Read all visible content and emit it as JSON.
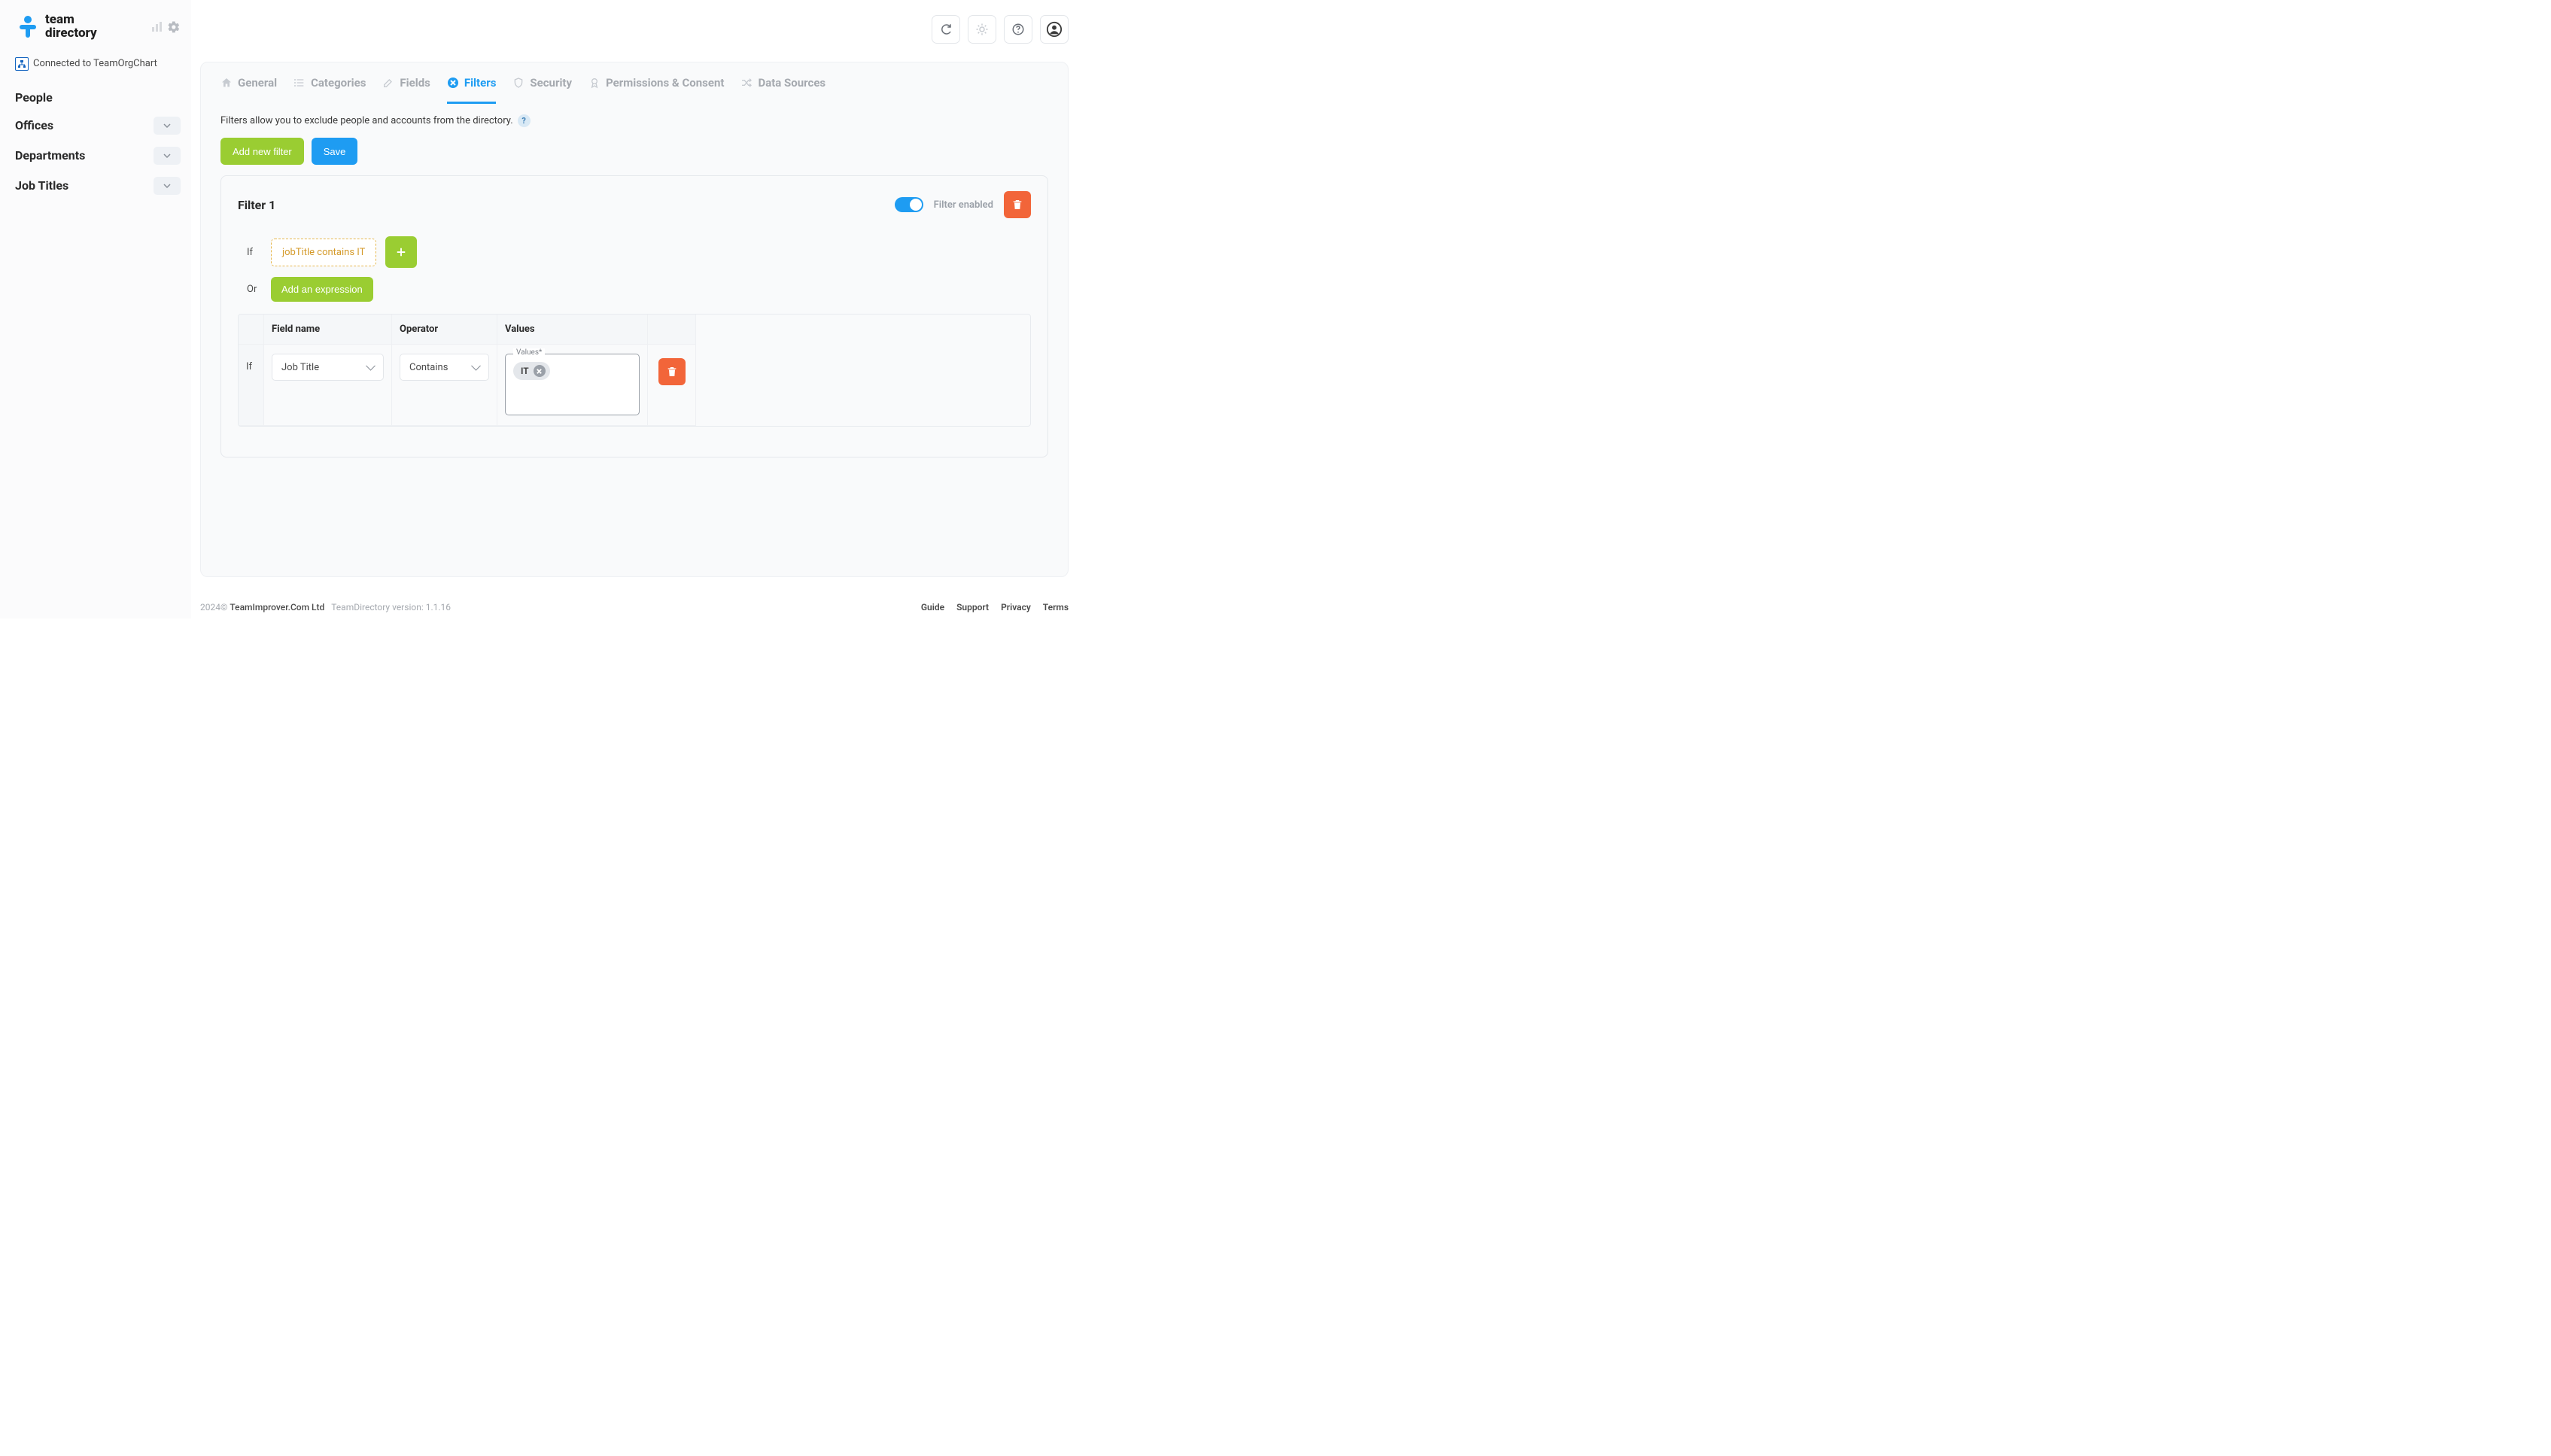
{
  "brand": {
    "line1": "team",
    "line2": "directory"
  },
  "connected": {
    "text": "Connected to TeamOrgChart"
  },
  "nav": {
    "people": "People",
    "offices": "Offices",
    "departments": "Departments",
    "jobtitles": "Job Titles"
  },
  "tabs": {
    "general": "General",
    "categories": "Categories",
    "fields": "Fields",
    "filters": "Filters",
    "security": "Security",
    "permissions": "Permissions & Consent",
    "datasources": "Data Sources"
  },
  "filters": {
    "desc": "Filters allow you to exclude people and accounts from the directory.",
    "help": "?",
    "add_new": "Add new filter",
    "save": "Save",
    "card": {
      "title": "Filter 1",
      "enabled_label": "Filter enabled",
      "if": "If",
      "or": "Or",
      "chip": "jobTitle contains IT",
      "add_expression": "Add an expression"
    },
    "table": {
      "headers": {
        "field": "Field name",
        "operator": "Operator",
        "values": "Values"
      },
      "row": {
        "kw": "If",
        "field": "Job Title",
        "operator": "Contains",
        "values_label": "Values*",
        "tag": "IT"
      }
    }
  },
  "footer": {
    "year": "2024©",
    "company": "TeamImprover.Com Ltd",
    "version": "TeamDirectory version: 1.1.16",
    "links": {
      "guide": "Guide",
      "support": "Support",
      "privacy": "Privacy",
      "terms": "Terms"
    }
  }
}
